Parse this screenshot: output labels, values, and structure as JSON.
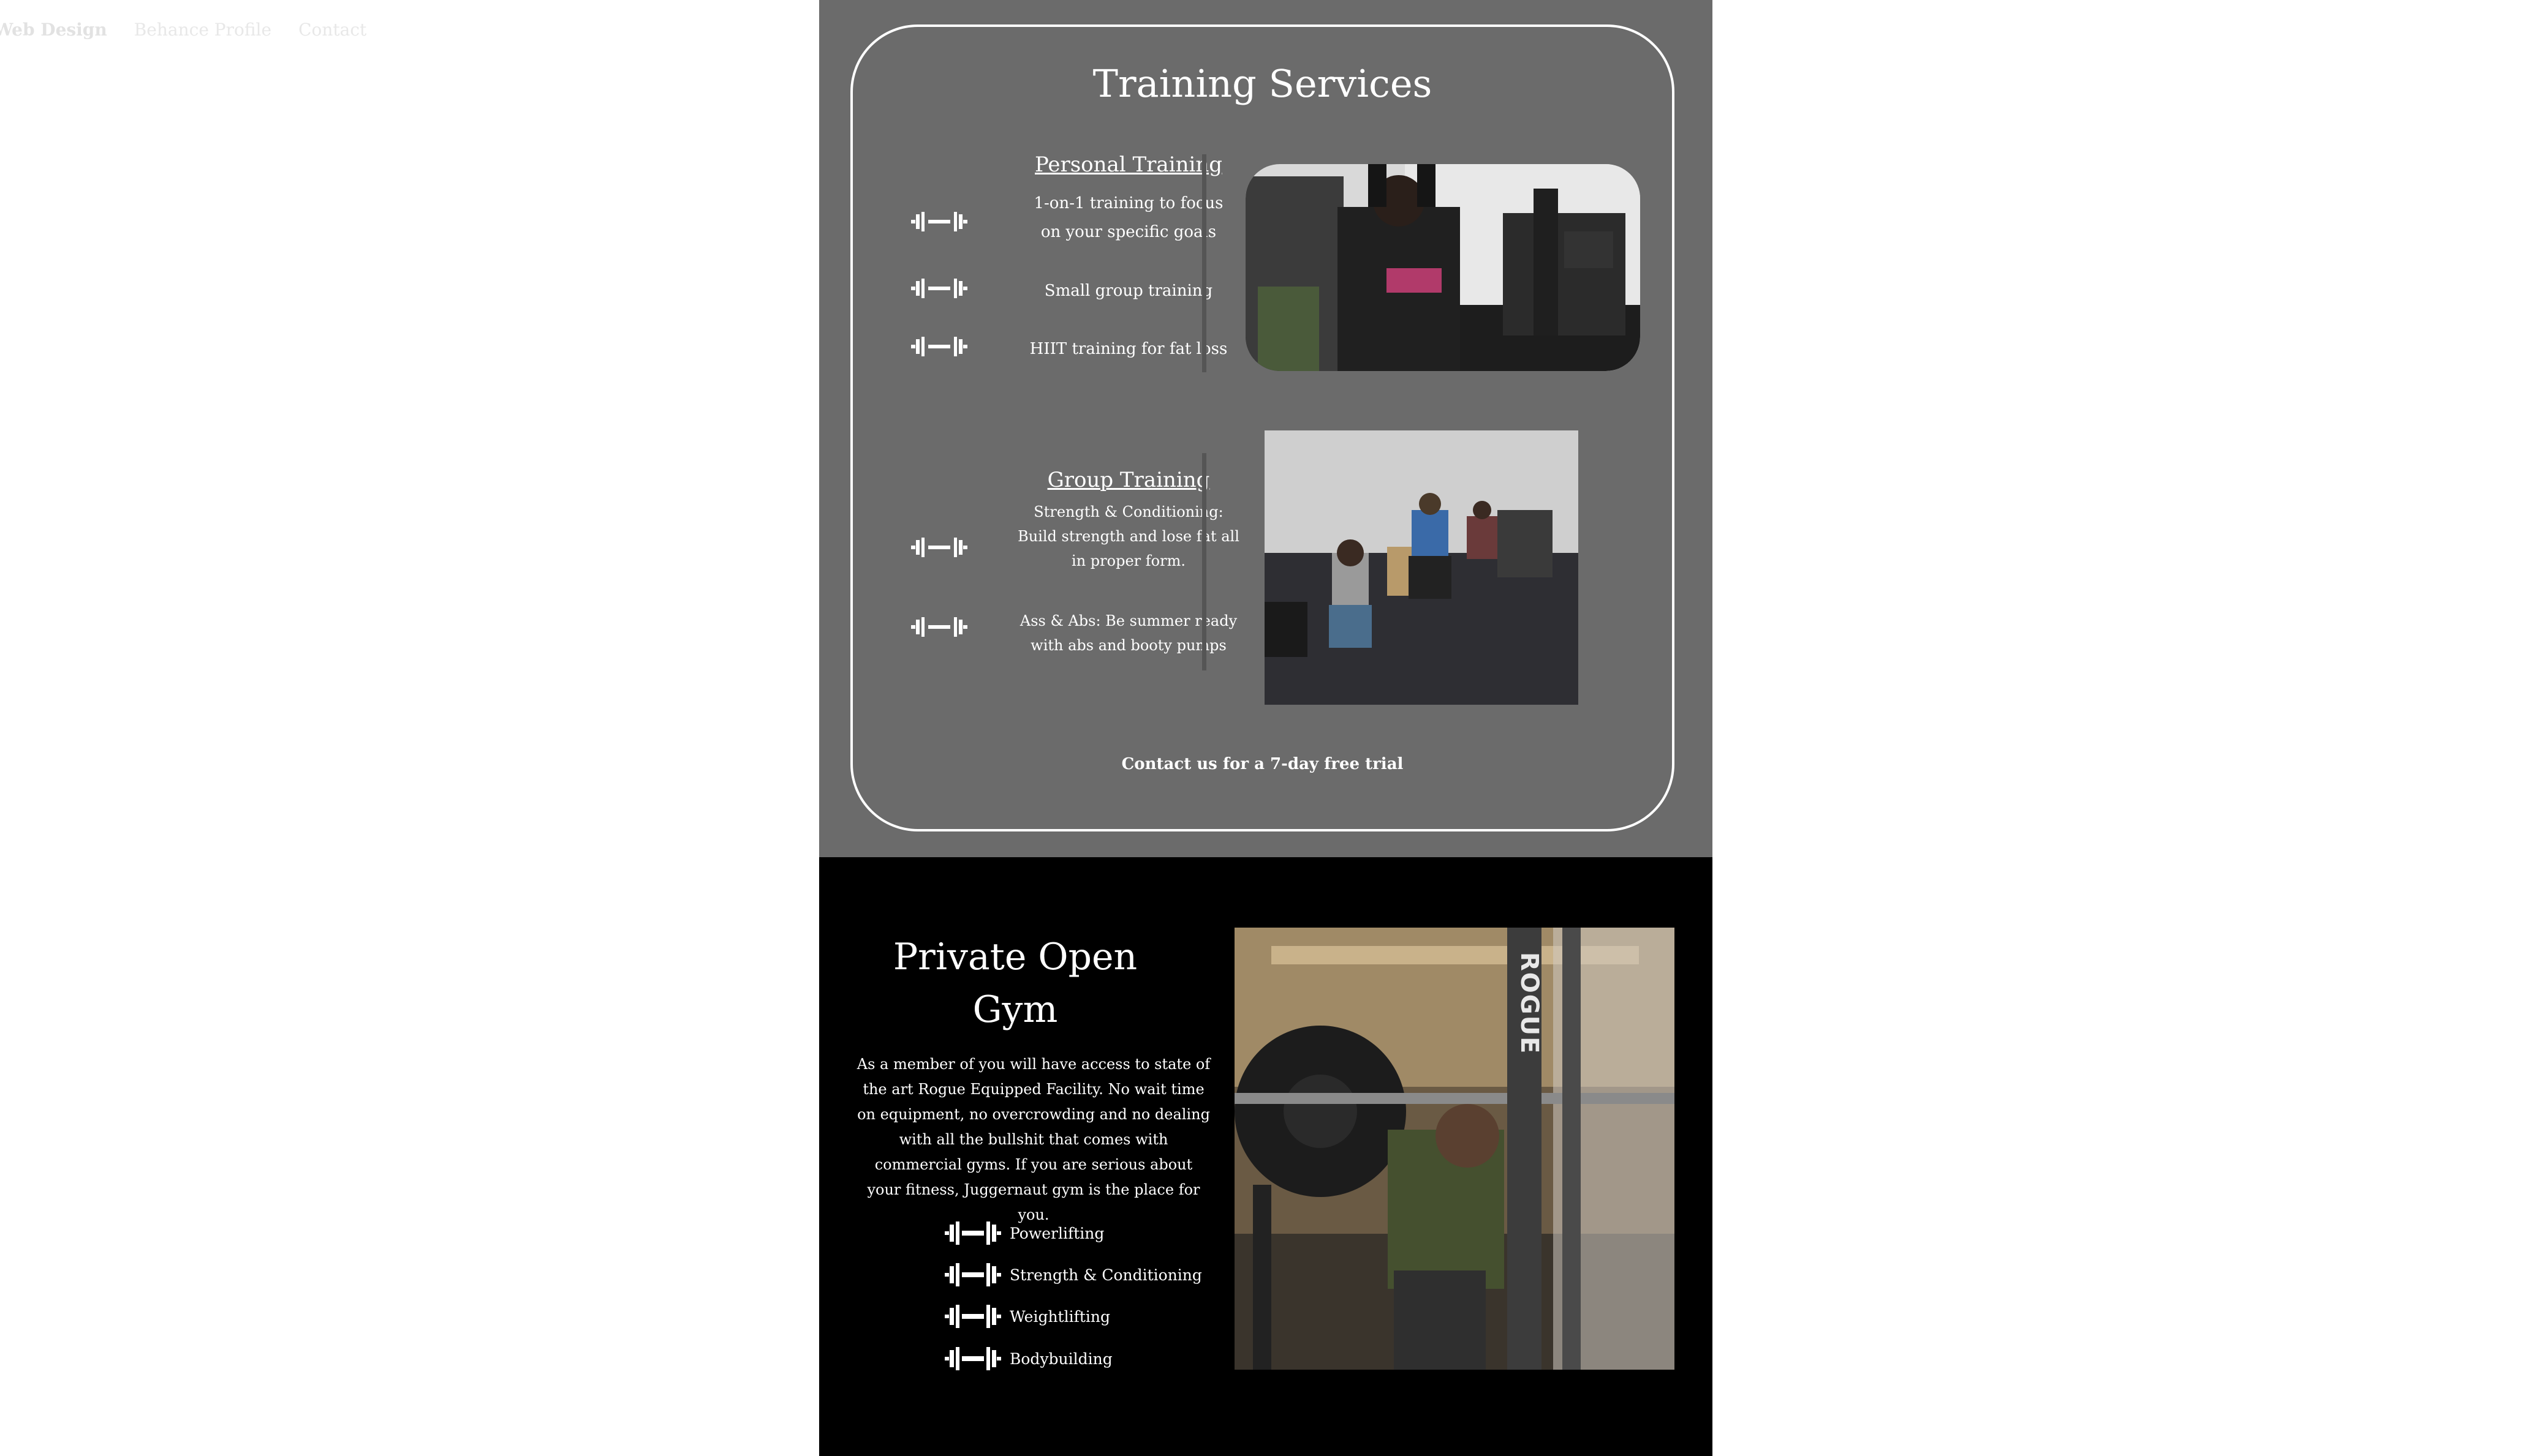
{
  "nav": {
    "items": [
      {
        "label": "Web Design",
        "active": true
      },
      {
        "label": "Behance Profile",
        "active": false
      },
      {
        "label": "Contact",
        "active": false
      }
    ]
  },
  "training": {
    "title": "Training Services",
    "personal": {
      "title": "Personal Training",
      "items": [
        {
          "line1": "1-on-1 training to focus",
          "line2": "on your specific goals"
        },
        {
          "line1": "Small group training",
          "line2": ""
        },
        {
          "line1": "HIIT training for fat loss",
          "line2": ""
        }
      ]
    },
    "group": {
      "title": "Group Training",
      "items": [
        {
          "lines": [
            "Strength & Conditioning:",
            "Build strength and lose fat all",
            "in proper form."
          ]
        },
        {
          "lines": [
            "Ass & Abs: Be summer ready",
            "with abs and booty pumps"
          ]
        }
      ]
    },
    "cta": "Contact us for a 7-day free trial",
    "icon": "barbell-icon"
  },
  "gym": {
    "title_line1": "Private Open",
    "title_line2": "Gym",
    "description": "As a member of you will have access to state of the art Rogue Equipped Facility. No wait time on equipment, no overcrowding and no dealing with all the bullshit that comes with commercial gyms. If you are serious about your fitness, Juggernaut gym is the place for you.",
    "list": [
      "Powerlifting",
      "Strength & Conditioning",
      "Weightlifting",
      "Bodybuilding"
    ],
    "rack_text": "ROGUE"
  },
  "colors": {
    "training_bg": "#6b6b6b",
    "gym_bg": "#000000",
    "text": "#ffffff"
  }
}
